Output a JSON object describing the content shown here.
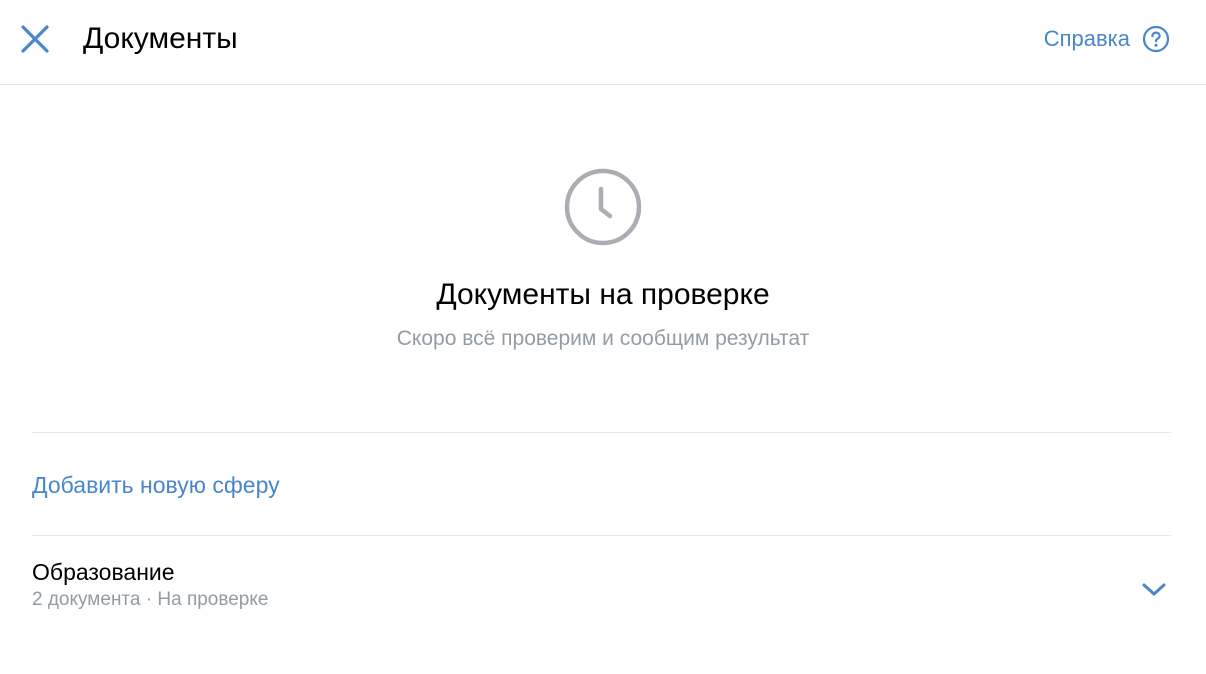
{
  "header": {
    "title": "Документы",
    "help_label": "Справка"
  },
  "status": {
    "title": "Документы на проверке",
    "subtitle": "Скоро всё проверим и сообщим результат"
  },
  "actions": {
    "add_sphere_label": "Добавить новую сферу"
  },
  "spheres": [
    {
      "name": "Образование",
      "meta": "2 документа · На проверке"
    }
  ],
  "colors": {
    "accent": "#4986cc",
    "secondary_text": "#939ca5",
    "icon_gray": "#aaaeb3",
    "divider": "#e7e8ec"
  },
  "icons": {
    "close": "close-icon",
    "help": "question-circle-icon",
    "status": "clock-icon",
    "expand": "chevron-down-icon"
  }
}
